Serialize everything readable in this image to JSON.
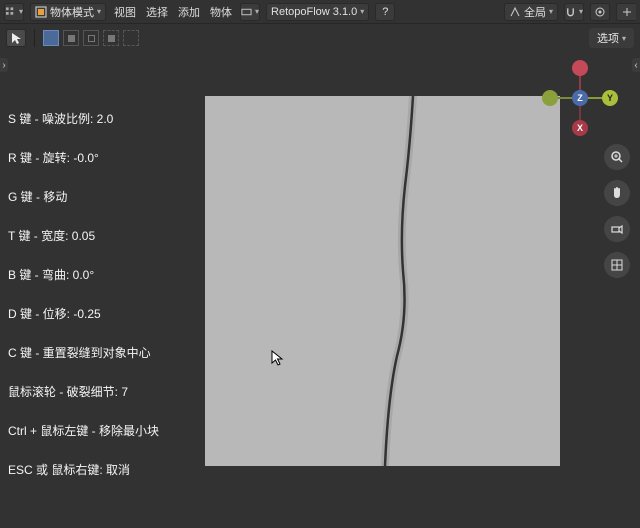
{
  "topbar": {
    "mode_label": "物体模式",
    "menu_view": "视图",
    "menu_select": "选择",
    "menu_add": "添加",
    "menu_object": "物体",
    "addon_label": "RetopoFlow 3.1.0",
    "global_label": "全局"
  },
  "secondbar": {
    "options_label": "选项"
  },
  "side": {
    "s": "S 键 - 噪波比例:  2.0",
    "r": "R 键 - 旋转:  -0.0°",
    "g": "G 键 - 移动",
    "t": "T 键 - 宽度:  0.05",
    "b": "B 键 - 弯曲:  0.0°",
    "d": "D 键 - 位移:  -0.25",
    "c": "C 键 - 重置裂缝到对象中心",
    "wheel": "鼠标滚轮 - 破裂细节:  7",
    "ctrl": "Ctrl + 鼠标左键 - 移除最小块",
    "esc": "ESC 或 鼠标右键: 取消"
  },
  "gizmo": {
    "x": "X",
    "y": "Y",
    "z": "Z"
  }
}
